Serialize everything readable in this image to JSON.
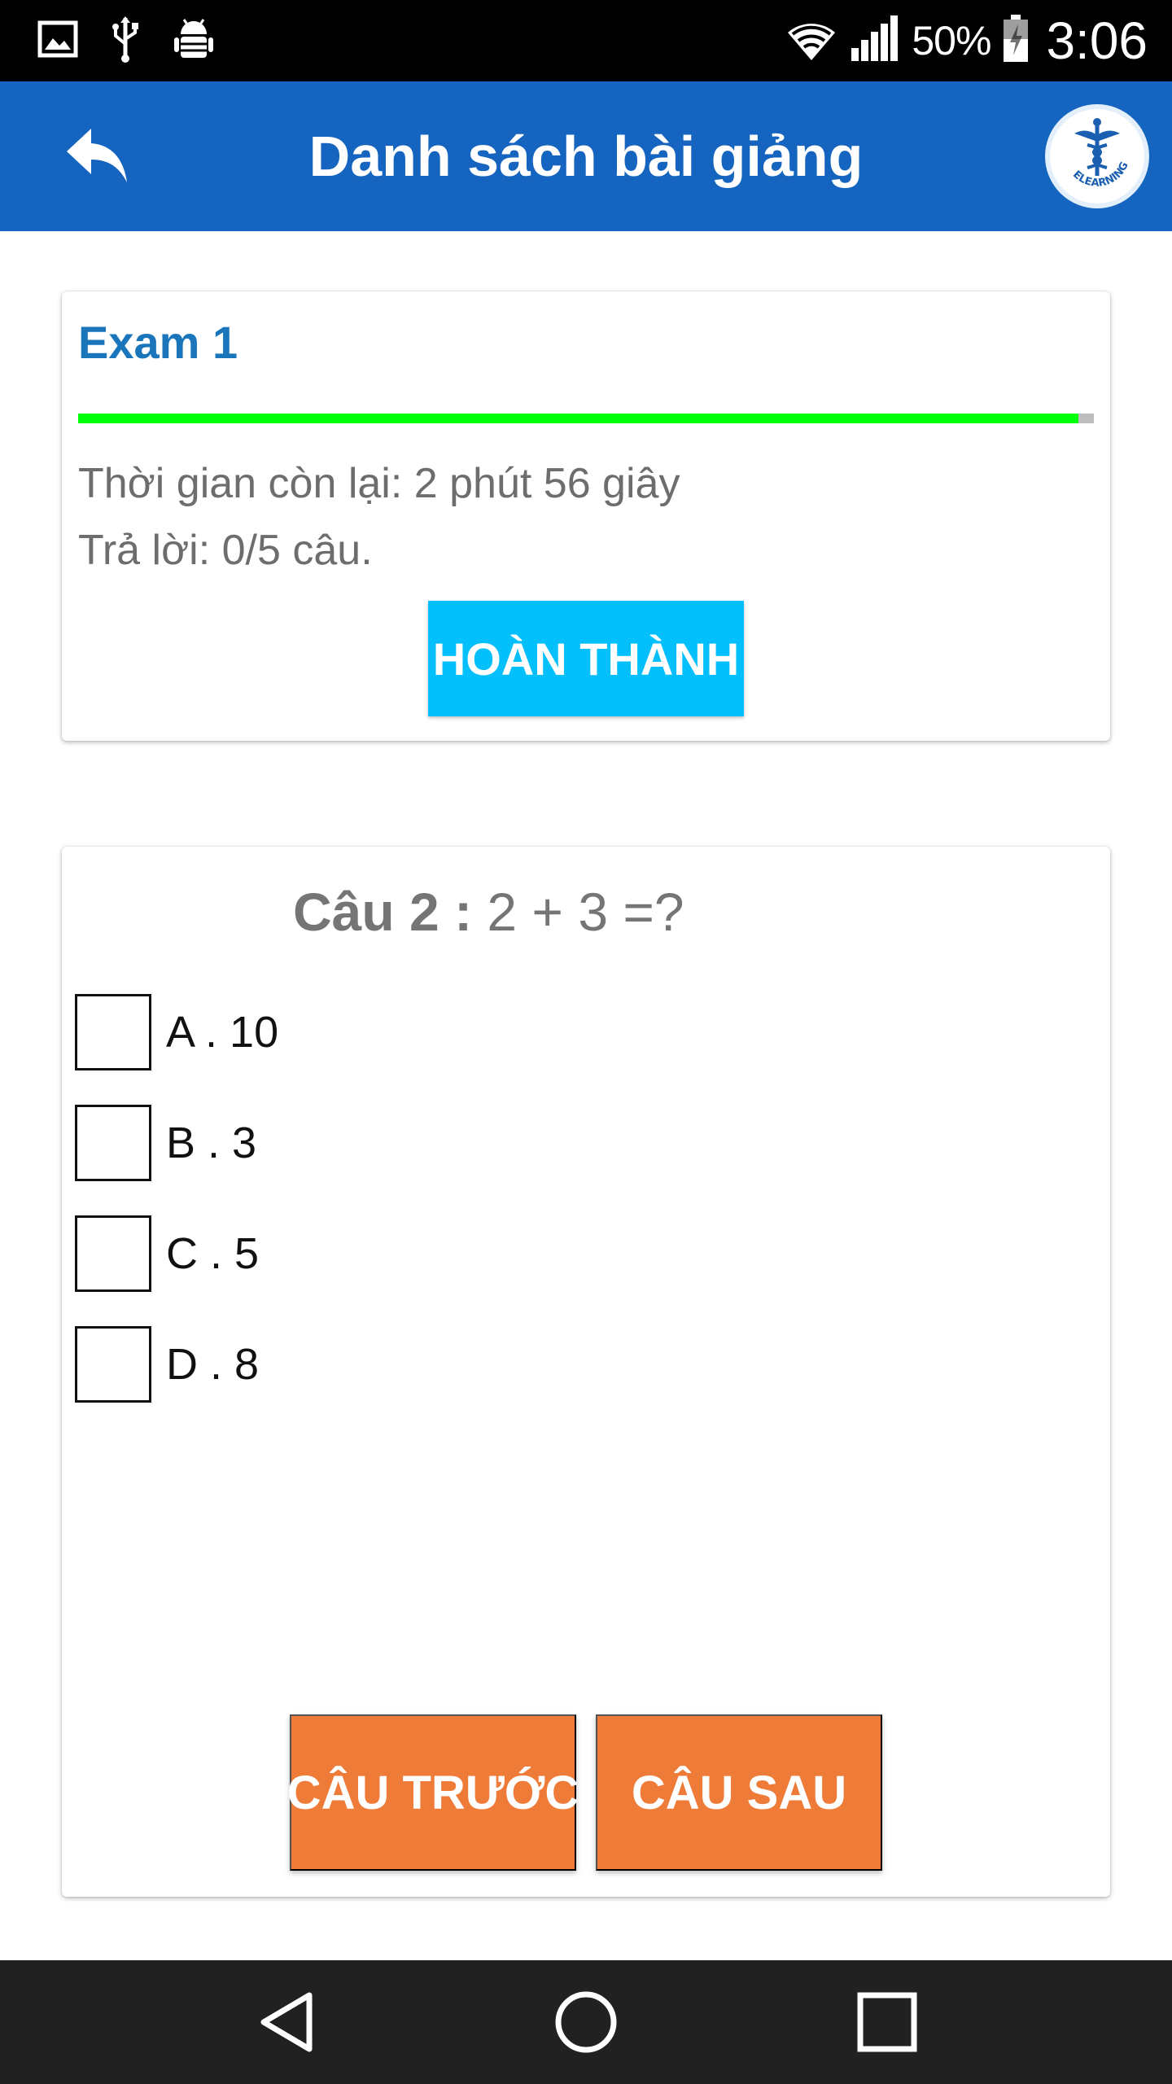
{
  "status_bar": {
    "battery_percent": "50%",
    "time": "3:06",
    "icons": [
      "image-icon",
      "usb-icon",
      "android-debug-icon",
      "wifi-icon",
      "signal-icon",
      "battery-charging-icon"
    ]
  },
  "app_bar": {
    "title": "Danh sách bài giảng",
    "back_icon": "reply-arrow-icon",
    "logo_text": "ELEARNING",
    "color": "#1565c0"
  },
  "exam": {
    "title": "Exam 1",
    "progress_fraction": 0.985,
    "time_remaining": "Thời gian còn lại: 2 phút 56 giây",
    "answered": "Trả lời: 0/5 câu.",
    "finish_label": "HOÀN THÀNH",
    "progress_color": "#00ff0a",
    "finish_color": "#03c0fd"
  },
  "question": {
    "number_label": "Câu 2 :",
    "text": "2 + 3 =?",
    "options": [
      {
        "label": "A . 10",
        "checked": false
      },
      {
        "label": "B . 3",
        "checked": false
      },
      {
        "label": "C . 5",
        "checked": false
      },
      {
        "label": "D . 8",
        "checked": false
      }
    ],
    "prev_label": "CÂU TRƯỚC",
    "next_label": "CÂU SAU",
    "nav_color": "#ef7b38"
  },
  "system_nav": {
    "icons": [
      "nav-back-icon",
      "nav-home-icon",
      "nav-recents-icon"
    ]
  }
}
